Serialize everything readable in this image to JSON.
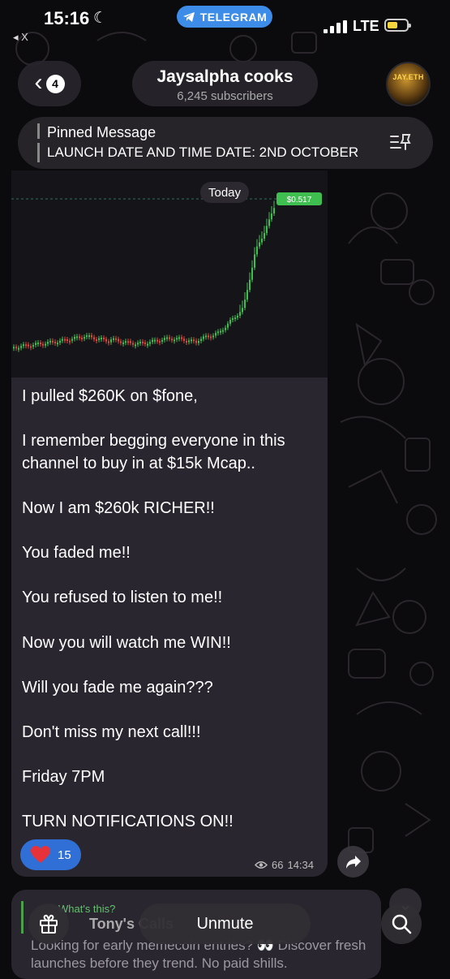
{
  "status_bar": {
    "time": "15:16",
    "app_pill": "TELEGRAM",
    "back_app": "◂ X",
    "network": "LTE"
  },
  "header": {
    "back_count": "4",
    "title": "Jaysalpha cooks",
    "subscribers": "6,245 subscribers",
    "avatar_text": "JAY.ETH"
  },
  "pinned": {
    "title": "Pinned Message",
    "text": "LAUNCH DATE AND TIME DATE: 2ND OCTOBER"
  },
  "message": {
    "date_chip": "Today",
    "price_label": "$0.517",
    "text": "I pulled $260K on $fone,\n\nI remember begging everyone in this channel to buy in at $15k Mcap..\n\nNow I am $260k RICHER!!\n\nYou faded me!!\n\nYou refused to listen to me!!\n\nNow you will watch me WIN!!\n\nWill you fade me again???\n\nDon't miss my next call!!!\n\nFriday 7PM\n\nTURN NOTIFICATIONS ON!!",
    "reaction_count": "15",
    "views": "66",
    "time": "14:34",
    "colors": {
      "up": "#3fbf4f",
      "down": "#e0483a",
      "accent": "#2f6fd6"
    }
  },
  "next_message": {
    "small_text": "What's this?",
    "name": "Tony's Calls",
    "body": "Looking for early memecoin entries? 👀 Discover fresh launches before they trend. No paid shills."
  },
  "bottom_bar": {
    "unmute_label": "Unmute"
  }
}
